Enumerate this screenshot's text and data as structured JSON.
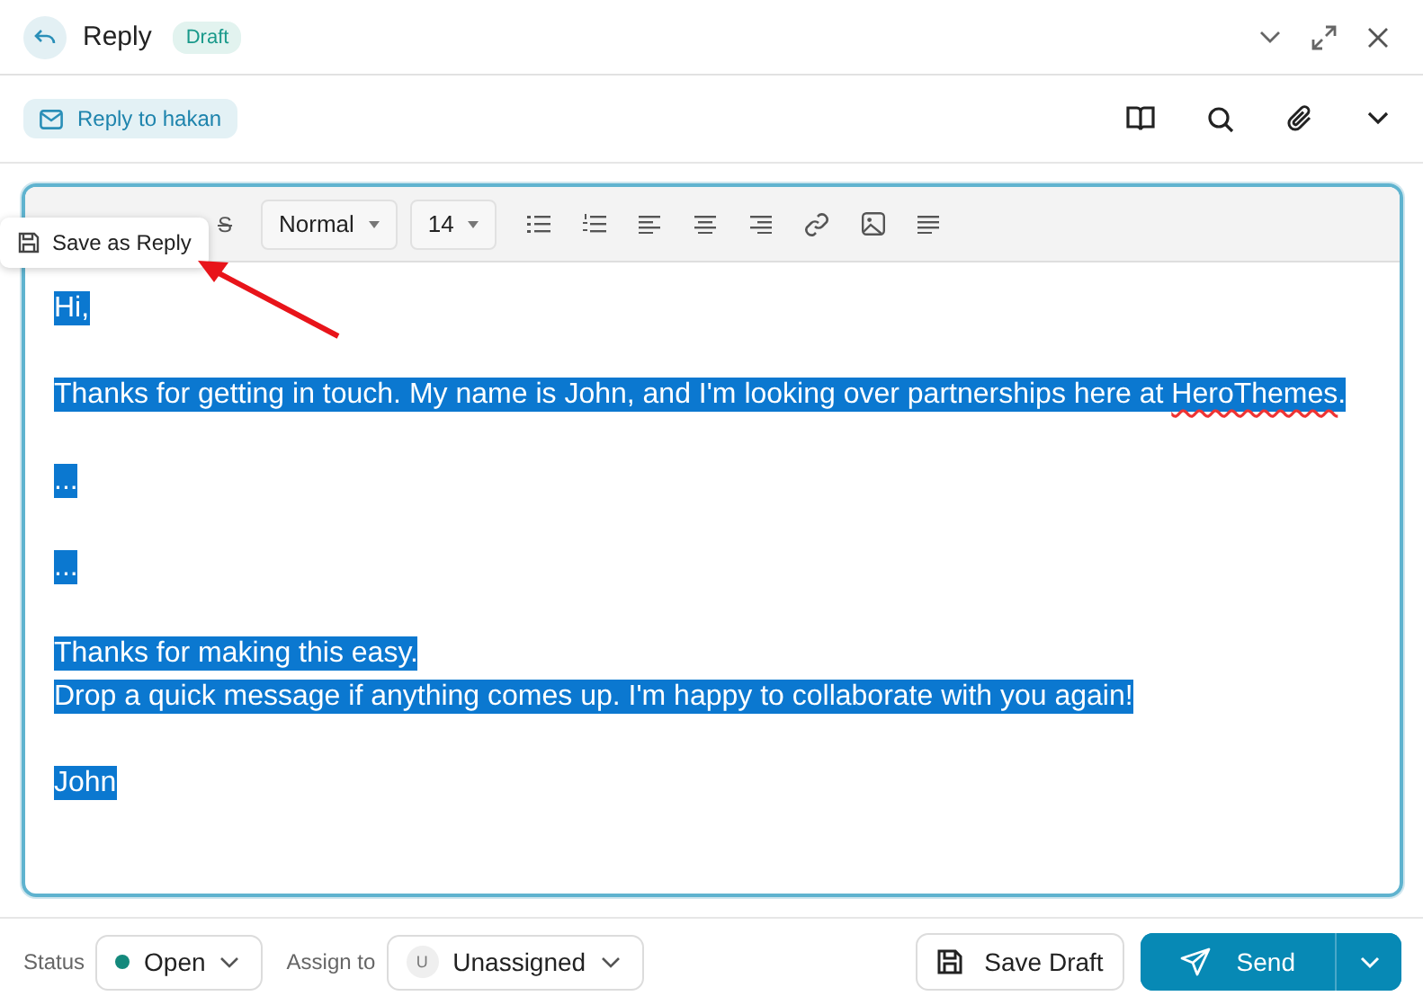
{
  "header": {
    "title": "Reply",
    "badge": "Draft"
  },
  "recipient": {
    "label": "Reply to hakan"
  },
  "toolbar": {
    "strike": "S",
    "style": "Normal",
    "size": "14"
  },
  "popover": {
    "label": "Save as Reply"
  },
  "body": {
    "selected": true,
    "blocks": [
      {
        "lines": [
          [
            {
              "text": "Hi,"
            }
          ]
        ]
      },
      {
        "lines": [
          [
            {
              "text": "Thanks for getting in touch. My name is John, and I'm looking over partnerships here at "
            },
            {
              "text": "HeroThemes",
              "misspelled": true
            },
            {
              "text": "."
            }
          ]
        ]
      },
      {
        "lines": [
          [
            {
              "text": "..."
            }
          ]
        ]
      },
      {
        "lines": [
          [
            {
              "text": "..."
            }
          ]
        ]
      },
      {
        "lines": [
          [
            {
              "text": "Thanks for making this easy."
            }
          ],
          [
            {
              "text": "Drop a quick message if anything comes up. I'm happy to collaborate with you again!"
            }
          ]
        ]
      },
      {
        "lines": [
          [
            {
              "text": "John"
            }
          ]
        ]
      }
    ]
  },
  "footer": {
    "status_label": "Status",
    "status": {
      "value": "Open",
      "color": "#14897c"
    },
    "assign_label": "Assign to",
    "assignee": {
      "initial": "U",
      "name": "Unassigned"
    },
    "save_draft": "Save Draft",
    "send": "Send"
  }
}
